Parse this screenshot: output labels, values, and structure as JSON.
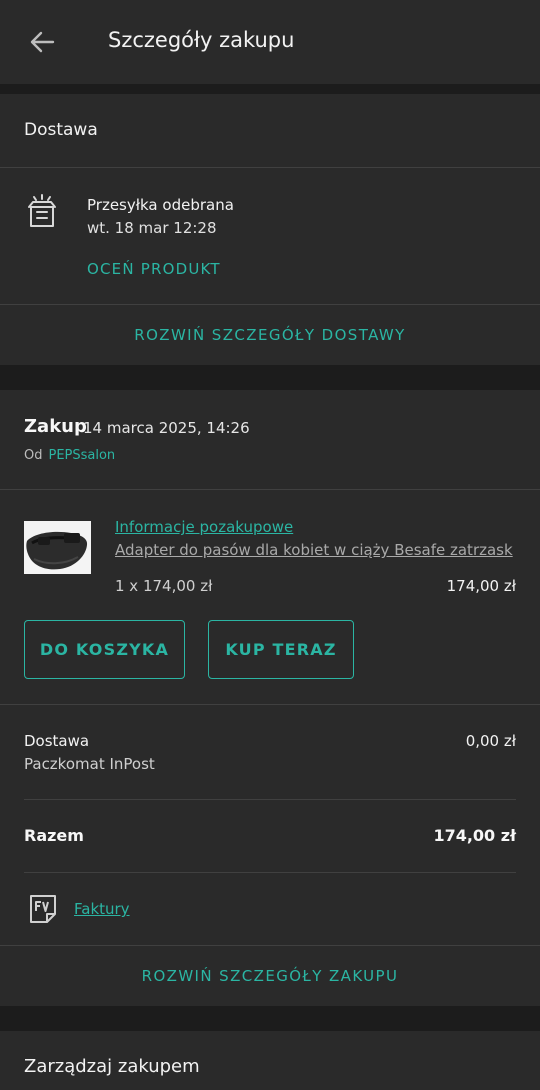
{
  "header": {
    "title": "Szczegóły zakupu",
    "back_icon": "arrow-back-icon"
  },
  "delivery": {
    "heading": "Dostawa",
    "status_icon": "package-delivered-icon",
    "status_title": "Przesyłka odebrana",
    "status_date": "wt. 18 mar 12:28",
    "rate_label": "OCEŃ PRODUKT",
    "expand_label": "ROZWIŃ SZCZEGÓŁY DOSTAWY"
  },
  "purchase": {
    "title": "Zakup",
    "date": "14 marca 2025, 14:26",
    "seller_prefix": "Od",
    "seller_name": "PEPSsalon",
    "item": {
      "info_link": "Informacje pozakupowe",
      "name": "Adapter do pasów dla kobiet w ciąży Besafe zatrzask",
      "quantity_line": "1 x 174,00 zł",
      "line_total": "174,00 zł"
    },
    "buttons": {
      "cart": "DO KOSZYKA",
      "buy_now": "KUP TERAZ"
    },
    "shipping": {
      "label": "Dostawa",
      "method": "Paczkomat InPost",
      "price": "0,00 zł"
    },
    "total": {
      "label": "Razem",
      "value": "174,00 zł"
    },
    "invoices": {
      "icon": "invoice-fv-icon",
      "label": "Faktury"
    },
    "expand_label": "ROZWIŃ SZCZEGÓŁY ZAKUPU"
  },
  "manage": {
    "title": "Zarządzaj zakupem"
  },
  "colors": {
    "accent": "#2bb5a3",
    "card": "#2a2a2a",
    "background": "#1c1c1c",
    "divider": "#404040"
  }
}
